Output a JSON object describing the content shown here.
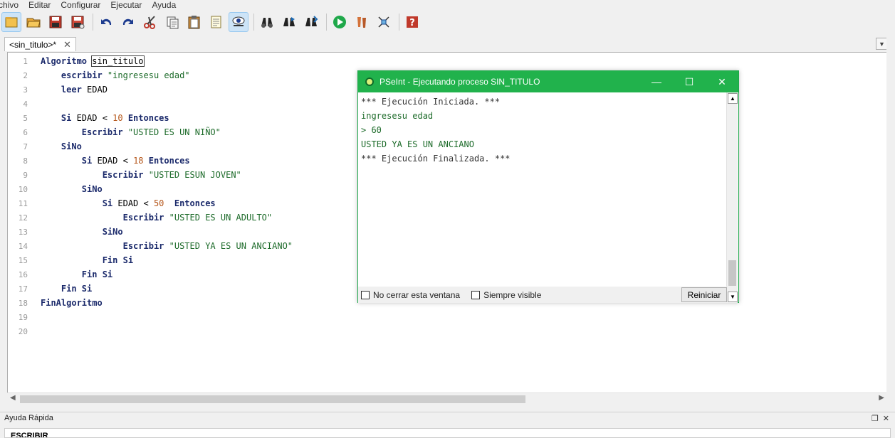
{
  "menu": [
    "rchivo",
    "Editar",
    "Configurar",
    "Ejecutar",
    "Ayuda"
  ],
  "toolbar_icons": [
    "open-folder-icon",
    "save-icon",
    "save-as-icon",
    "undo-icon",
    "redo-icon",
    "cut-icon",
    "copy-icon",
    "paste-icon",
    "edit-list-icon",
    "find-eye-icon",
    "binoculars-icon",
    "find-next-icon",
    "replace-icon",
    "run-icon",
    "step-icon",
    "flowchart-icon",
    "help-icon"
  ],
  "tab": {
    "label": "<sin_titulo>*",
    "close": "✕"
  },
  "editor": {
    "line_numbers": [
      "1",
      "2",
      "3",
      "4",
      "5",
      "6",
      "7",
      "8",
      "9",
      "10",
      "11",
      "12",
      "13",
      "14",
      "15",
      "16",
      "17",
      "18",
      "19",
      "20"
    ],
    "lines": [
      [
        {
          "t": "Algoritmo ",
          "c": "kw"
        },
        {
          "t": "sin_titulo",
          "c": "id sel"
        }
      ],
      [
        {
          "t": "    escribir ",
          "c": "kw"
        },
        {
          "t": "\"ingresesu edad\"",
          "c": "str"
        }
      ],
      [
        {
          "t": "    leer ",
          "c": "kw"
        },
        {
          "t": "EDAD",
          "c": "id"
        }
      ],
      [],
      [
        {
          "t": "    Si ",
          "c": "kw"
        },
        {
          "t": "EDAD < ",
          "c": "id"
        },
        {
          "t": "10",
          "c": "num"
        },
        {
          "t": " Entonces",
          "c": "kw"
        }
      ],
      [
        {
          "t": "        Escribir ",
          "c": "kw"
        },
        {
          "t": "\"USTED ES UN NIÑO\"",
          "c": "str"
        }
      ],
      [
        {
          "t": "    SiNo",
          "c": "kw"
        }
      ],
      [
        {
          "t": "        Si ",
          "c": "kw"
        },
        {
          "t": "EDAD < ",
          "c": "id"
        },
        {
          "t": "18",
          "c": "num"
        },
        {
          "t": " Entonces",
          "c": "kw"
        }
      ],
      [
        {
          "t": "            Escribir ",
          "c": "kw"
        },
        {
          "t": "\"USTED ESUN JOVEN\"",
          "c": "str"
        }
      ],
      [
        {
          "t": "        SiNo",
          "c": "kw"
        }
      ],
      [
        {
          "t": "            Si ",
          "c": "kw"
        },
        {
          "t": "EDAD < ",
          "c": "id"
        },
        {
          "t": "50",
          "c": "num"
        },
        {
          "t": "  Entonces",
          "c": "kw"
        }
      ],
      [
        {
          "t": "                Escribir ",
          "c": "kw"
        },
        {
          "t": "\"USTED ES UN ADULTO\"",
          "c": "str"
        }
      ],
      [
        {
          "t": "            SiNo",
          "c": "kw"
        }
      ],
      [
        {
          "t": "                Escribir ",
          "c": "kw"
        },
        {
          "t": "\"USTED YA ES UN ANCIANO\"",
          "c": "str"
        }
      ],
      [
        {
          "t": "            Fin Si",
          "c": "kw"
        }
      ],
      [
        {
          "t": "        Fin Si",
          "c": "kw"
        }
      ],
      [
        {
          "t": "    Fin Si",
          "c": "kw"
        }
      ],
      [
        {
          "t": "FinAlgoritmo",
          "c": "kw"
        }
      ],
      [],
      []
    ]
  },
  "quick_help": {
    "title": "Ayuda Rápida",
    "body": "ESCRIBIR"
  },
  "run_window": {
    "title": "PSeInt - Ejecutando proceso SIN_TITULO",
    "output": [
      {
        "text": "*** Ejecución Iniciada. ***",
        "style": "n"
      },
      {
        "text": "ingresesu edad",
        "style": "g"
      },
      {
        "text": "> 60",
        "style": "g"
      },
      {
        "text": "USTED YA ES UN ANCIANO",
        "style": "g"
      },
      {
        "text": "*** Ejecución Finalizada. ***",
        "style": "n"
      }
    ],
    "keep_open_label": "No cerrar esta ventana",
    "always_visible_label": "Siempre visible",
    "restart_label": "Reiniciar"
  },
  "colors": {
    "window_titlebar": "#21b24c",
    "keyword": "#1b2a6b",
    "string": "#1d6b2a",
    "number": "#b5561a"
  }
}
